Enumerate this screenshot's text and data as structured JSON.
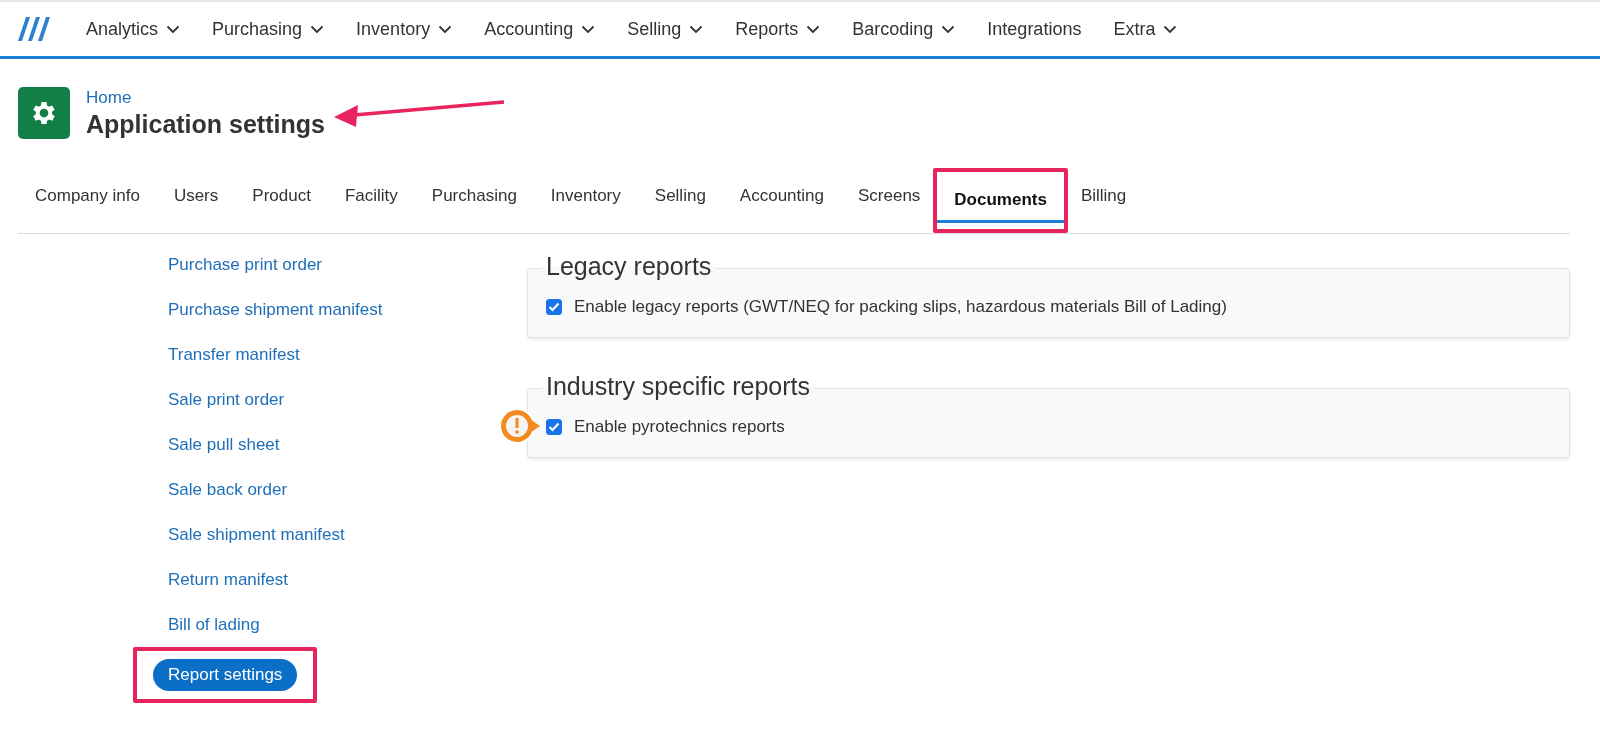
{
  "nav": {
    "items": [
      {
        "label": "Analytics",
        "dropdown": true
      },
      {
        "label": "Purchasing",
        "dropdown": true
      },
      {
        "label": "Inventory",
        "dropdown": true
      },
      {
        "label": "Accounting",
        "dropdown": true
      },
      {
        "label": "Selling",
        "dropdown": true
      },
      {
        "label": "Reports",
        "dropdown": true
      },
      {
        "label": "Barcoding",
        "dropdown": true
      },
      {
        "label": "Integrations",
        "dropdown": false
      },
      {
        "label": "Extra",
        "dropdown": true
      }
    ]
  },
  "header": {
    "breadcrumb": "Home",
    "title": "Application settings",
    "arrow": true
  },
  "tabs": [
    {
      "label": "Company info",
      "selected": false,
      "highlighted": false
    },
    {
      "label": "Users",
      "selected": false,
      "highlighted": false
    },
    {
      "label": "Product",
      "selected": false,
      "highlighted": false
    },
    {
      "label": "Facility",
      "selected": false,
      "highlighted": false
    },
    {
      "label": "Purchasing",
      "selected": false,
      "highlighted": false
    },
    {
      "label": "Inventory",
      "selected": false,
      "highlighted": false
    },
    {
      "label": "Selling",
      "selected": false,
      "highlighted": false
    },
    {
      "label": "Accounting",
      "selected": false,
      "highlighted": false
    },
    {
      "label": "Screens",
      "selected": false,
      "highlighted": false
    },
    {
      "label": "Documents",
      "selected": true,
      "highlighted": true
    },
    {
      "label": "Billing",
      "selected": false,
      "highlighted": false
    }
  ],
  "sidebar": {
    "items": [
      {
        "label": "Purchase print order",
        "selected": false,
        "highlighted": false
      },
      {
        "label": "Purchase shipment manifest",
        "selected": false,
        "highlighted": false
      },
      {
        "label": "Transfer manifest",
        "selected": false,
        "highlighted": false
      },
      {
        "label": "Sale print order",
        "selected": false,
        "highlighted": false
      },
      {
        "label": "Sale pull sheet",
        "selected": false,
        "highlighted": false
      },
      {
        "label": "Sale back order",
        "selected": false,
        "highlighted": false
      },
      {
        "label": "Sale shipment manifest",
        "selected": false,
        "highlighted": false
      },
      {
        "label": "Return manifest",
        "selected": false,
        "highlighted": false
      },
      {
        "label": "Bill of lading",
        "selected": false,
        "highlighted": false
      },
      {
        "label": "Report settings",
        "selected": true,
        "highlighted": true
      }
    ]
  },
  "panels": [
    {
      "title": "Legacy reports",
      "options": [
        {
          "label": "Enable legacy reports (GWT/NEQ for packing slips, hazardous materials Bill of Lading)",
          "checked": true,
          "flagged": false
        }
      ]
    },
    {
      "title": "Industry specific reports",
      "options": [
        {
          "label": "Enable pyrotechnics reports",
          "checked": true,
          "flagged": true
        }
      ]
    }
  ]
}
